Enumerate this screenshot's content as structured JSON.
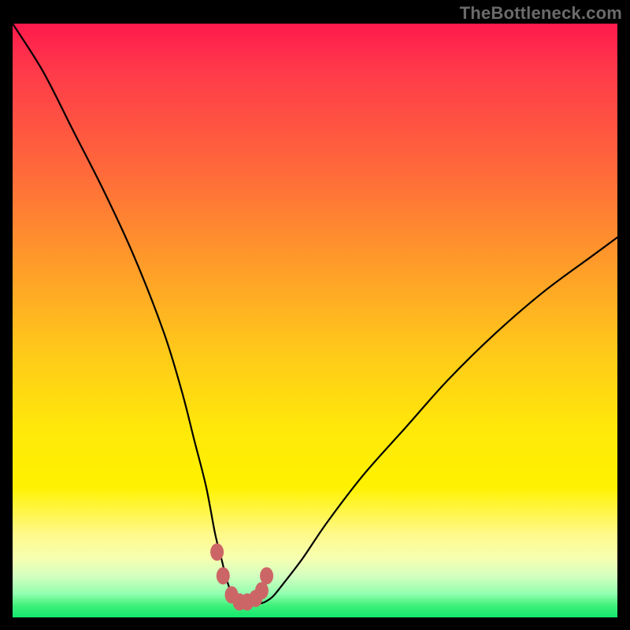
{
  "watermark": {
    "text": "TheBottleneck.com"
  },
  "colors": {
    "background": "#000000",
    "curve_stroke": "#000000",
    "marker_fill": "#cc6666",
    "marker_stroke": "#cc6666"
  },
  "chart_data": {
    "type": "line",
    "title": "",
    "xlabel": "",
    "ylabel": "",
    "xlim": [
      0,
      100
    ],
    "ylim": [
      0,
      100
    ],
    "grid": false,
    "legend": false,
    "series": [
      {
        "name": "bottleneck-curve",
        "x": [
          0,
          5,
          10,
          15,
          20,
          25,
          28,
          30,
          32,
          33.5,
          34.5,
          35.5,
          36.5,
          37.5,
          38.5,
          39.5,
          40.5,
          41.5,
          43,
          45,
          48,
          52,
          58,
          65,
          72,
          80,
          88,
          96,
          100
        ],
        "y": [
          100,
          92,
          82,
          72,
          61,
          48,
          38,
          30,
          22,
          14,
          10,
          6,
          3.5,
          2.5,
          2.3,
          2.3,
          2.3,
          2.5,
          3.5,
          6,
          10,
          16,
          24,
          32,
          40,
          48,
          55,
          61,
          64
        ]
      }
    ],
    "markers": {
      "name": "optimal-range",
      "x": [
        33.8,
        34.8,
        36.2,
        37.5,
        38.8,
        40.2,
        41.2,
        42.0
      ],
      "y": [
        11.0,
        7.0,
        3.8,
        2.6,
        2.6,
        3.2,
        4.5,
        7.0
      ]
    }
  }
}
